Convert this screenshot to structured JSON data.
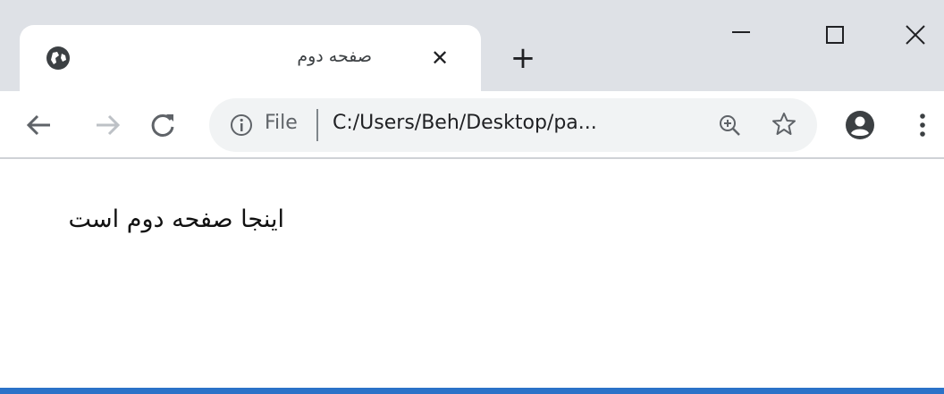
{
  "tab": {
    "title": "صفحه دوم",
    "close_label": "✕",
    "icon": "globe-icon"
  },
  "new_tab_label": "+",
  "window_controls": [
    "minimize-icon",
    "maximize-icon",
    "close-icon"
  ],
  "toolbar": {
    "icons": [
      "back-arrow-icon",
      "forward-arrow-icon",
      "reload-icon"
    ]
  },
  "omnibox": {
    "scheme_label": "File",
    "url": "C:/Users/Beh/Desktop/pa...",
    "icons": [
      "info-icon",
      "zoom-icon",
      "bookmark-star-icon"
    ]
  },
  "profile_icon": "account-circle-icon",
  "menu_icon": "more-vert-icon",
  "page": {
    "text": "اینجا صفحه دوم است"
  },
  "colors": {
    "tab_strip": "#dee1e6",
    "omnibox_bg": "#f1f3f4",
    "taskbar_accent": "#2b72c8"
  }
}
